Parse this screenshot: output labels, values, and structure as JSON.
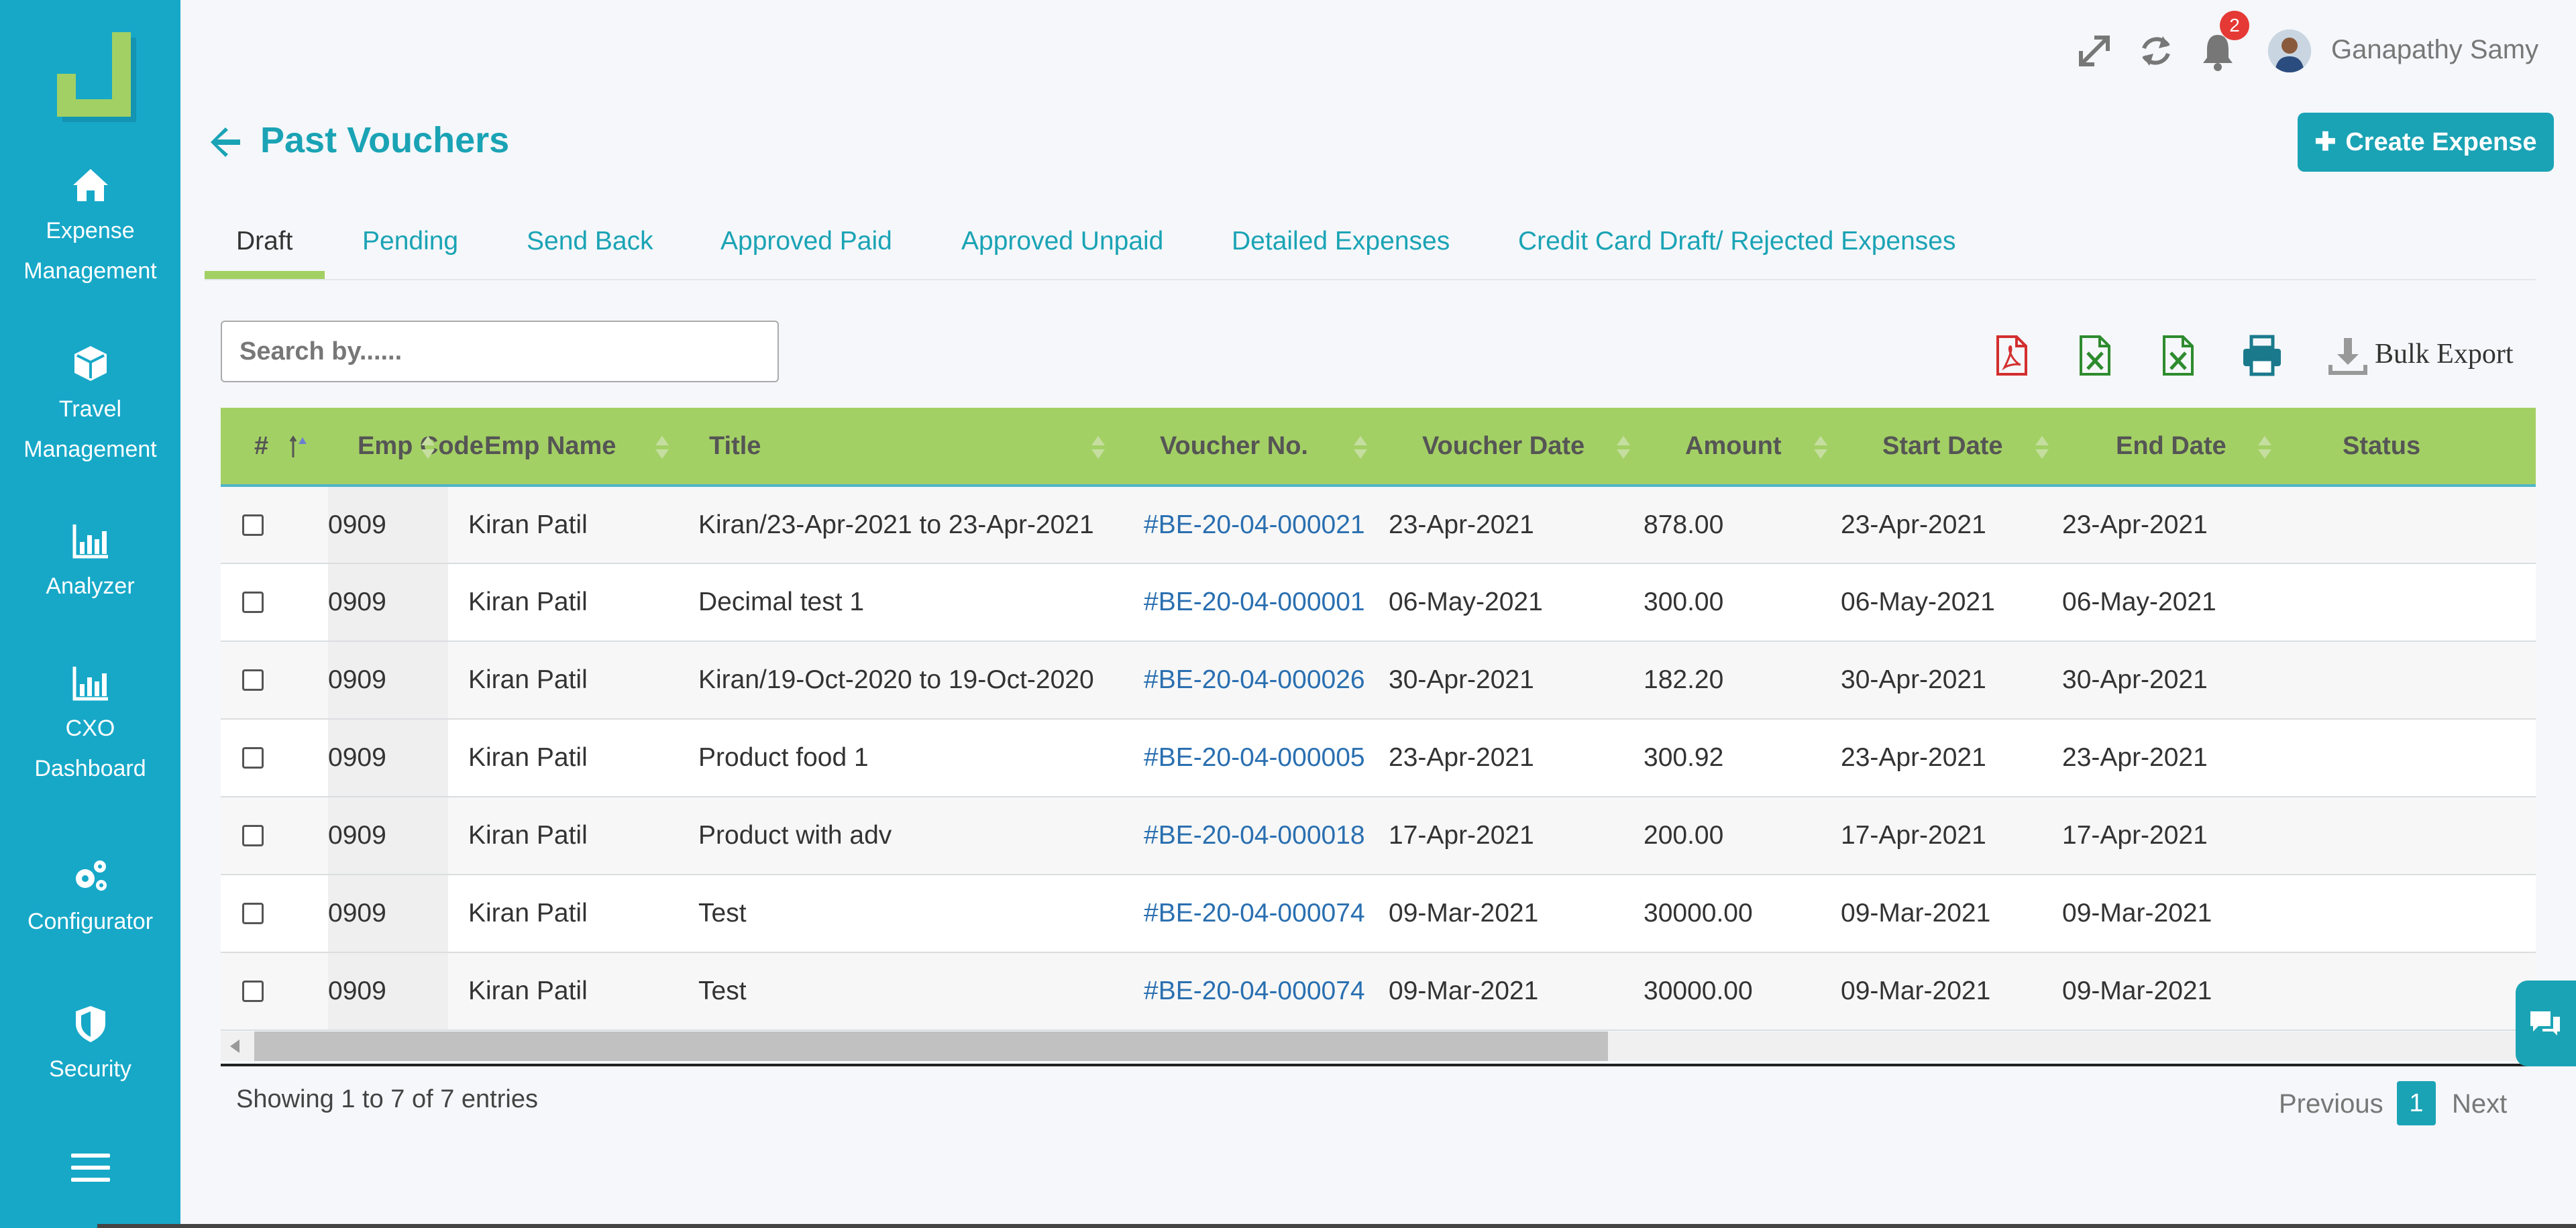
{
  "sidebar": {
    "items": [
      {
        "label_line1": "Expense",
        "label_line2": "Management",
        "icon": "home-icon"
      },
      {
        "label_line1": "Travel",
        "label_line2": "Management",
        "icon": "cube-icon"
      },
      {
        "label_line1": "Analyzer",
        "label_line2": "",
        "icon": "bar-chart-icon"
      },
      {
        "label_line1": "CXO",
        "label_line2": "Dashboard",
        "icon": "bar-chart-icon"
      },
      {
        "label_line1": "Configurator",
        "label_line2": "",
        "icon": "gears-icon"
      },
      {
        "label_line1": "Security",
        "label_line2": "",
        "icon": "shield-icon"
      }
    ]
  },
  "header": {
    "notification_count": "2",
    "user_name": "Ganapathy Samy"
  },
  "page": {
    "title": "Past Vouchers",
    "create_label": "Create Expense"
  },
  "tabs": [
    "Draft",
    "Pending",
    "Send Back",
    "Approved Paid",
    "Approved Unpaid",
    "Detailed Expenses",
    "Credit Card Draft/ Rejected Expenses"
  ],
  "search": {
    "placeholder": "Search by......"
  },
  "toolbar": {
    "bulk_export_label": "Bulk Export"
  },
  "table": {
    "columns": [
      "#",
      "Emp Code",
      "Emp Name",
      "Title",
      "Voucher No.",
      "Voucher Date",
      "Amount",
      "Start Date",
      "End Date",
      "Status"
    ],
    "rows": [
      {
        "emp_code": "0909",
        "emp_name": "Kiran Patil",
        "title": "Kiran/23-Apr-2021 to 23-Apr-2021",
        "voucher_no": "#BE-20-04-000021",
        "voucher_date": "23-Apr-2021",
        "amount": "878.00",
        "start_date": "23-Apr-2021",
        "end_date": "23-Apr-2021",
        "status": ""
      },
      {
        "emp_code": "0909",
        "emp_name": "Kiran Patil",
        "title": "Decimal test 1",
        "voucher_no": "#BE-20-04-000001",
        "voucher_date": "06-May-2021",
        "amount": "300.00",
        "start_date": "06-May-2021",
        "end_date": "06-May-2021",
        "status": ""
      },
      {
        "emp_code": "0909",
        "emp_name": "Kiran Patil",
        "title": "Kiran/19-Oct-2020 to 19-Oct-2020",
        "voucher_no": "#BE-20-04-000026",
        "voucher_date": "30-Apr-2021",
        "amount": "182.20",
        "start_date": "30-Apr-2021",
        "end_date": "30-Apr-2021",
        "status": ""
      },
      {
        "emp_code": "0909",
        "emp_name": "Kiran Patil",
        "title": "Product food 1",
        "voucher_no": "#BE-20-04-000005",
        "voucher_date": "23-Apr-2021",
        "amount": "300.92",
        "start_date": "23-Apr-2021",
        "end_date": "23-Apr-2021",
        "status": ""
      },
      {
        "emp_code": "0909",
        "emp_name": "Kiran Patil",
        "title": "Product with adv",
        "voucher_no": "#BE-20-04-000018",
        "voucher_date": "17-Apr-2021",
        "amount": "200.00",
        "start_date": "17-Apr-2021",
        "end_date": "17-Apr-2021",
        "status": ""
      },
      {
        "emp_code": "0909",
        "emp_name": "Kiran Patil",
        "title": "Test",
        "voucher_no": "#BE-20-04-000074",
        "voucher_date": "09-Mar-2021",
        "amount": "30000.00",
        "start_date": "09-Mar-2021",
        "end_date": "09-Mar-2021",
        "status": ""
      },
      {
        "emp_code": "0909",
        "emp_name": "Kiran Patil",
        "title": "Test",
        "voucher_no": "#BE-20-04-000074",
        "voucher_date": "09-Mar-2021",
        "amount": "30000.00",
        "start_date": "09-Mar-2021",
        "end_date": "09-Mar-2021",
        "status": ""
      }
    ]
  },
  "footer": {
    "entries_text": "Showing 1 to 7 of 7 entries",
    "prev_label": "Previous",
    "current_page": "1",
    "next_label": "Next"
  },
  "colors": {
    "sidebar": "#17a8c8",
    "accent": "#1aa3b5",
    "header_row": "#a3d064",
    "link": "#2a6fb0",
    "pdf": "#d32f2f",
    "excel": "#2e8b2e"
  }
}
